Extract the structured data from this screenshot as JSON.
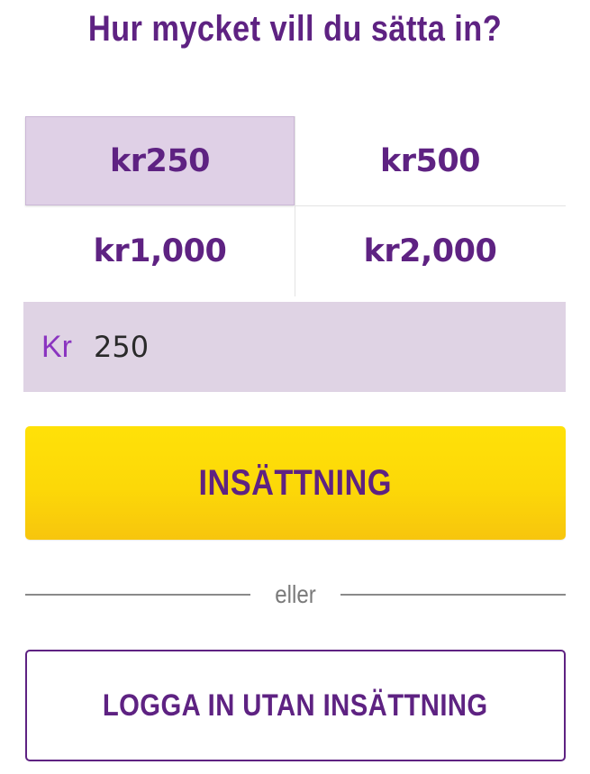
{
  "title": "Hur mycket vill du sätta in?",
  "amounts": [
    {
      "label": "kr250",
      "selected": true
    },
    {
      "label": "kr500",
      "selected": false
    },
    {
      "label": "kr1,000",
      "selected": false
    },
    {
      "label": "kr2,000",
      "selected": false
    }
  ],
  "amount_input": {
    "currency": "Kr",
    "value": "250"
  },
  "deposit_button": {
    "label": "INSÄTTNING"
  },
  "divider": {
    "label": "eller"
  },
  "login_button": {
    "label": "LOGGA IN UTAN INSÄTTNING"
  },
  "colors": {
    "brand_purple": "#5e2282",
    "selected_bg": "#dfd0e6",
    "input_bg": "#dfd3e4",
    "button_yellow": "#fcd808"
  }
}
